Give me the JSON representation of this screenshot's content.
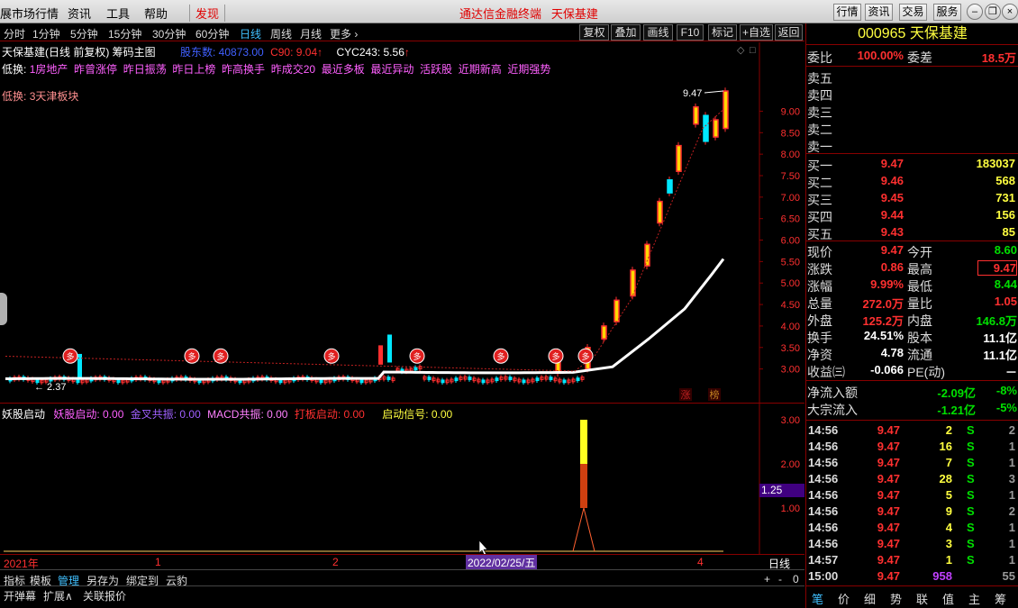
{
  "menubar": {
    "items": [
      "展市场行情",
      "资讯",
      "工具",
      "帮助"
    ],
    "discover": "发现",
    "center_title": "通达信金融终端   天保基建",
    "buttons": [
      "行情",
      "资讯",
      "交易",
      "服务"
    ]
  },
  "periods": [
    "分时",
    "1分钟",
    "5分钟",
    "15分钟",
    "30分钟",
    "60分钟",
    "日线",
    "周线",
    "月线",
    "更多 ›"
  ],
  "toolbar": [
    "复权",
    "叠加",
    "画线",
    "F10",
    "标记",
    "+自选",
    "返回"
  ],
  "chart_header": {
    "name": "天保基建(日线 前复权) 筹码主图",
    "shareholders": "股东数: 40873.00",
    "c90": "C90: 9.04",
    "cyc243": "CYC243: 5.56"
  },
  "lines": {
    "line1_label": "低换:",
    "line1_text": "1房地产  昨曾涨停  昨日振荡  昨日上榜  昨高换手  昨成交20  最近多板  最近异动  活跃股  近期新高  近期强势",
    "line2_label": "低换:",
    "line2_text": "3天津板块"
  },
  "price_axis": [
    "9.00",
    "8.50",
    "8.00",
    "7.50",
    "7.00",
    "6.50",
    "6.00",
    "5.50",
    "5.00",
    "4.50",
    "4.00",
    "3.50",
    "3.00"
  ],
  "annotations": {
    "high": "9.47",
    "low": "2.37",
    "zhang": "涨",
    "bang": "榜",
    "duo": "多"
  },
  "indicator": {
    "name": "妖股启动",
    "f1": "妖股启动: 0.00",
    "f2": "金叉共振: 0.00",
    "f3": "MACD共振: 0.00",
    "f4": "打板启动: 0.00",
    "f5": "启动信号: 0.00",
    "axis": [
      "3.00",
      "2.00",
      "1.00"
    ],
    "current": "1.25"
  },
  "date_axis": {
    "year": "2021年",
    "m1": "1",
    "m2": "2",
    "cursor_date": "2022/02/25/五",
    "m4": "4",
    "period": "日线"
  },
  "bottom_bar": [
    "指标",
    "模板",
    "管理",
    "另存为",
    "绑定到",
    "云豹"
  ],
  "bottom_bar2": [
    "开弹幕",
    "扩展∧",
    "关联报价"
  ],
  "zoom": [
    "+",
    "-",
    "0"
  ],
  "stock": {
    "code": "000965",
    "name": "天保基建",
    "weibi_label": "委比",
    "weibi": "100.00%",
    "weicha_label": "委差",
    "weicha": "18.5万"
  },
  "asks": [
    {
      "label": "卖五",
      "price": "",
      "vol": ""
    },
    {
      "label": "卖四",
      "price": "",
      "vol": ""
    },
    {
      "label": "卖三",
      "price": "",
      "vol": ""
    },
    {
      "label": "卖二",
      "price": "",
      "vol": ""
    },
    {
      "label": "卖一",
      "price": "",
      "vol": ""
    }
  ],
  "bids": [
    {
      "label": "买一",
      "price": "9.47",
      "vol": "183037"
    },
    {
      "label": "买二",
      "price": "9.46",
      "vol": "568"
    },
    {
      "label": "买三",
      "price": "9.45",
      "vol": "731"
    },
    {
      "label": "买四",
      "price": "9.44",
      "vol": "156"
    },
    {
      "label": "买五",
      "price": "9.43",
      "vol": "85"
    }
  ],
  "quote": [
    {
      "l1": "现价",
      "v1": "9.47",
      "l2": "今开",
      "v2": "8.60"
    },
    {
      "l1": "涨跌",
      "v1": "0.86",
      "l2": "最高",
      "v2": "9.47"
    },
    {
      "l1": "涨幅",
      "v1": "9.99%",
      "l2": "最低",
      "v2": "8.44"
    },
    {
      "l1": "总量",
      "v1": "272.0万",
      "l2": "量比",
      "v2": "1.05"
    },
    {
      "l1": "外盘",
      "v1": "125.2万",
      "l2": "内盘",
      "v2": "146.8万"
    },
    {
      "l1": "换手",
      "v1": "24.51%",
      "l2": "股本",
      "v2": "11.1亿"
    },
    {
      "l1": "净资",
      "v1": "4.78",
      "l2": "流通",
      "v2": "11.1亿"
    },
    {
      "l1": "收益㈢",
      "v1": "-0.066",
      "l2": "PE(动)",
      "v2": "－"
    }
  ],
  "flow": [
    {
      "label": "净流入额",
      "v1": "-2.09亿",
      "v2": "-8%"
    },
    {
      "label": "大宗流入",
      "v1": "-1.21亿",
      "v2": "-5%"
    }
  ],
  "ticks": [
    {
      "t": "14:56",
      "p": "9.47",
      "v": "2",
      "s": "S",
      "n": "2"
    },
    {
      "t": "14:56",
      "p": "9.47",
      "v": "16",
      "s": "S",
      "n": "1"
    },
    {
      "t": "14:56",
      "p": "9.47",
      "v": "7",
      "s": "S",
      "n": "1"
    },
    {
      "t": "14:56",
      "p": "9.47",
      "v": "28",
      "s": "S",
      "n": "3"
    },
    {
      "t": "14:56",
      "p": "9.47",
      "v": "5",
      "s": "S",
      "n": "1"
    },
    {
      "t": "14:56",
      "p": "9.47",
      "v": "9",
      "s": "S",
      "n": "2"
    },
    {
      "t": "14:56",
      "p": "9.47",
      "v": "4",
      "s": "S",
      "n": "1"
    },
    {
      "t": "14:56",
      "p": "9.47",
      "v": "3",
      "s": "S",
      "n": "1"
    },
    {
      "t": "14:57",
      "p": "9.47",
      "v": "1",
      "s": "S",
      "n": "1"
    },
    {
      "t": "15:00",
      "p": "9.47",
      "v": "958",
      "s": "",
      "n": "55"
    }
  ],
  "right_tabs": [
    "笔",
    "价",
    "细",
    "势",
    "联",
    "值",
    "主",
    "筹"
  ],
  "colors": {
    "up": "#ff3030",
    "down": "#00e8ff",
    "ma": "#ffffff",
    "bg": "#000000"
  }
}
